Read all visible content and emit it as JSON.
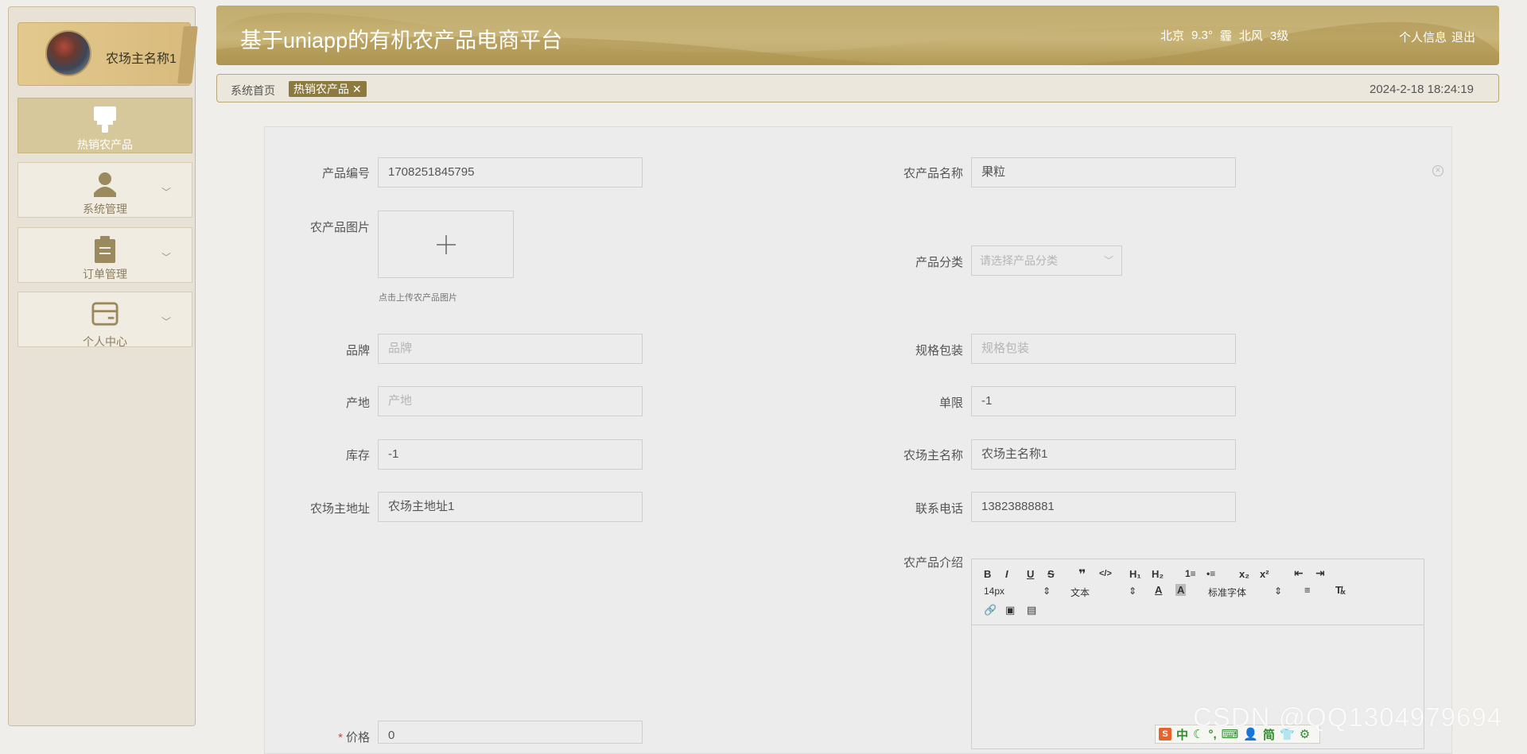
{
  "sidebar": {
    "user_name": "农场主名称1",
    "menu": [
      {
        "label": "热销农产品",
        "icon": "brush-icon",
        "active": true
      },
      {
        "label": "系统管理",
        "icon": "user-icon"
      },
      {
        "label": "订单管理",
        "icon": "clipboard-icon"
      },
      {
        "label": "个人中心",
        "icon": "wallet-icon"
      }
    ]
  },
  "header": {
    "title": "基于uniapp的有机农产品电商平台",
    "weather": {
      "city": "北京",
      "temp": "9.3°",
      "condition": "霾",
      "wind": "北风",
      "level": "3级"
    },
    "profile_link": "个人信息",
    "logout_link": "退出"
  },
  "tabbar": {
    "home": "系统首页",
    "active_tab": "热销农产品",
    "datetime": "2024-2-18 18:24:19"
  },
  "form": {
    "product_no": {
      "label": "产品编号",
      "value": "1708251845795"
    },
    "product_name": {
      "label": "农产品名称",
      "value": "果粒"
    },
    "image": {
      "label": "农产品图片",
      "hint": "点击上传农产品图片"
    },
    "category": {
      "label": "产品分类",
      "placeholder": "请选择产品分类"
    },
    "brand": {
      "label": "品牌",
      "placeholder": "品牌"
    },
    "spec": {
      "label": "规格包装",
      "placeholder": "规格包装"
    },
    "origin": {
      "label": "产地",
      "placeholder": "产地"
    },
    "limit": {
      "label": "单限",
      "value": "-1"
    },
    "stock": {
      "label": "库存",
      "value": "-1"
    },
    "farmer_name": {
      "label": "农场主名称",
      "value": "农场主名称1"
    },
    "farmer_address": {
      "label": "农场主地址",
      "value": "农场主地址1"
    },
    "phone": {
      "label": "联系电话",
      "value": "13823888881"
    },
    "intro": {
      "label": "农产品介绍"
    },
    "price": {
      "label": "价格",
      "value": "0",
      "required_mark": "*"
    }
  },
  "editor_toolbar": {
    "bold": "B",
    "italic": "I",
    "underline": "U",
    "strike": "S",
    "quote": "❞",
    "code": "</>",
    "h1": "H₁",
    "h2": "H₂",
    "ordered": "1≡",
    "bullet": "•≡",
    "sub": "x₂",
    "sup": "x²",
    "font_size": "14px",
    "text_type": "文本",
    "font_family": "标准字体",
    "clear": "T̸ₓ"
  },
  "ime_bar": {
    "logo": "S",
    "items": [
      "中",
      "☾",
      "°,",
      "⌨",
      "👤",
      "简",
      "👕",
      "⚙"
    ]
  },
  "watermark": "CSDN @QQ1304979694",
  "colors": {
    "header": "#b9a260",
    "accent": "#8c7a3e",
    "sidebar_active": "#d6c89a"
  }
}
